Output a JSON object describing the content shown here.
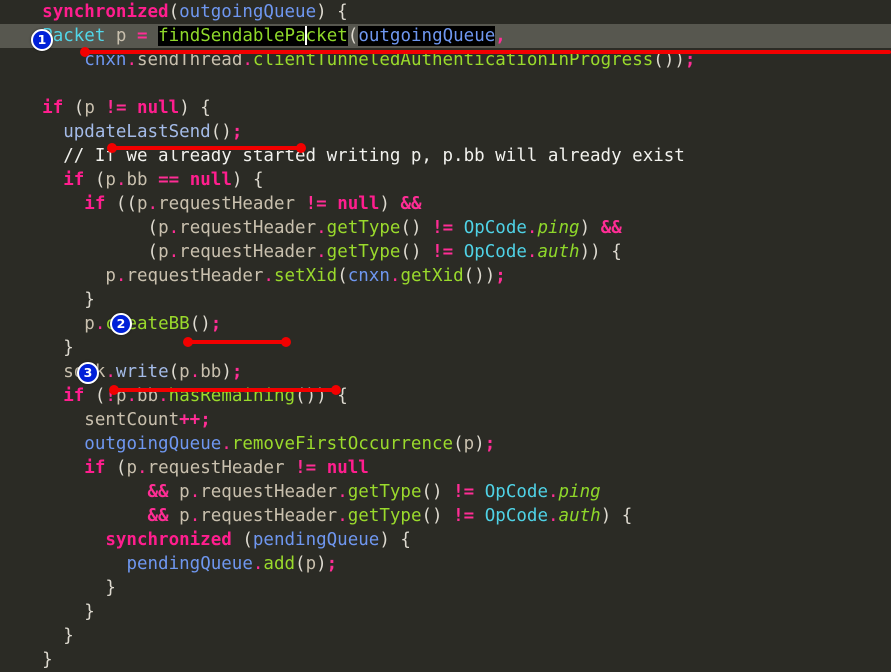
{
  "editor": {
    "background_color": "#2b2b25",
    "current_line_color": "#57574f",
    "selection_color": "#000000",
    "annotation_color": "#f20000",
    "badge_color": "#0020d8",
    "language": "java",
    "font_size_px": 17.5,
    "line_height_px": 24
  },
  "code": {
    "lines": [
      {
        "n": 1,
        "text": "    synchronized(outgoingQueue) {"
      },
      {
        "n": 2,
        "text": "        Packet p = findSendablePacket(outgoingQueue,"
      },
      {
        "n": 3,
        "text": "                cnxn.sendThread.clientTunneledAuthenticationInProgress());"
      },
      {
        "n": 4,
        "text": ""
      },
      {
        "n": 5,
        "text": "        if (p != null) {"
      },
      {
        "n": 6,
        "text": "            updateLastSend();"
      },
      {
        "n": 7,
        "text": "            // If we already started writing p, p.bb will already exist"
      },
      {
        "n": 8,
        "text": "            if (p.bb == null) {"
      },
      {
        "n": 9,
        "text": "                if ((p.requestHeader != null) &&"
      },
      {
        "n": 10,
        "text": "                        (p.requestHeader.getType() != OpCode.ping) &&"
      },
      {
        "n": 11,
        "text": "                        (p.requestHeader.getType() != OpCode.auth)) {"
      },
      {
        "n": 12,
        "text": "                    p.requestHeader.setXid(cnxn.getXid());"
      },
      {
        "n": 13,
        "text": "                }"
      },
      {
        "n": 14,
        "text": "                p.createBB();"
      },
      {
        "n": 15,
        "text": "            }"
      },
      {
        "n": 16,
        "text": "            sock.write(p.bb);"
      },
      {
        "n": 17,
        "text": "            if (!p.bb.hasRemaining()) {"
      },
      {
        "n": 18,
        "text": "                sentCount++;"
      },
      {
        "n": 19,
        "text": "                outgoingQueue.removeFirstOccurrence(p);"
      },
      {
        "n": 20,
        "text": "                if (p.requestHeader != null"
      },
      {
        "n": 21,
        "text": "                        && p.requestHeader.getType() != OpCode.ping"
      },
      {
        "n": 22,
        "text": "                        && p.requestHeader.getType() != OpCode.auth) {"
      },
      {
        "n": 23,
        "text": "                    synchronized (pendingQueue) {"
      },
      {
        "n": 24,
        "text": "                        pendingQueue.add(p);"
      },
      {
        "n": 25,
        "text": "                    }"
      },
      {
        "n": 26,
        "text": "                }"
      },
      {
        "n": 27,
        "text": "            }"
      },
      {
        "n": 28,
        "text": "        }"
      }
    ]
  },
  "selection": {
    "text": "findSendablePacket",
    "caret_after": "findSendablePa",
    "caret_before": "cket"
  },
  "annotations": [
    {
      "id": 1,
      "badge_label": "1",
      "target_line": 2,
      "target_text": "findSendablePacket(outgoingQueue,"
    },
    {
      "id": 2,
      "badge_label": "2",
      "target_line": 14,
      "target_text": "p.createBB();"
    },
    {
      "id": 3,
      "badge_label": "3",
      "target_line": 16,
      "target_text": "sock.write(p.bb);"
    }
  ]
}
